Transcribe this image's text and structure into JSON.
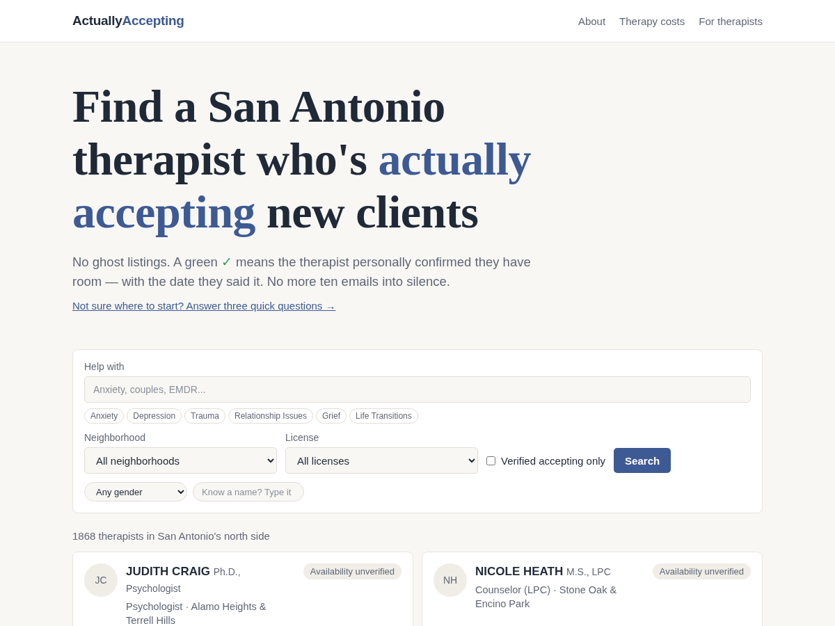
{
  "header": {
    "logo": [
      {
        "text": "Actually",
        "accent": false
      },
      {
        "text": "Accepting",
        "accent": true
      }
    ],
    "nav": [
      {
        "label": "About"
      },
      {
        "label": "Therapy costs"
      },
      {
        "label": "For therapists"
      }
    ]
  },
  "hero": {
    "heading": [
      {
        "text": "Find a San Antonio therapist who's ",
        "accent": false
      },
      {
        "text": "actually accepting",
        "accent": true
      },
      {
        "text": " new clients",
        "accent": false
      }
    ],
    "intro": [
      {
        "kind": "text",
        "text": "No ghost listings. A green "
      },
      {
        "kind": "check",
        "text": "✓"
      },
      {
        "kind": "text",
        "text": " means the therapist personally confirmed they have room — with the date they said it. No more ten emails into silence."
      }
    ],
    "quiz_link": "Not sure where to start? Answer three quick questions →"
  },
  "search": {
    "help_label": "Help with",
    "help_placeholder": "Anxiety, couples, EMDR...",
    "chips": [
      {
        "label": "Anxiety"
      },
      {
        "label": "Depression"
      },
      {
        "label": "Trauma"
      },
      {
        "label": "Relationship Issues"
      },
      {
        "label": "Grief"
      },
      {
        "label": "Life Transitions"
      }
    ],
    "neighborhood_label": "Neighborhood",
    "neighborhood_value": "All neighborhoods",
    "license_label": "License",
    "license_value": "All licenses",
    "verified_label": "Verified accepting only",
    "verified_checked": false,
    "search_button": "Search",
    "gender_value": "Any gender",
    "name_placeholder": "Know a name? Type it"
  },
  "results": {
    "count": "1868 therapists in San Antonio's north side",
    "therapists": [
      {
        "initials": "JC",
        "name": "JUDITH CRAIG",
        "credentials": "Ph.D., Psychologist",
        "details": "Psychologist · Alamo Heights & Terrell Hills",
        "badge": "Availability unverified"
      },
      {
        "initials": "NH",
        "name": "NICOLE HEATH",
        "credentials": "M.S., LPC",
        "details": "Counselor (LPC) · Stone Oak & Encino Park",
        "badge": "Availability unverified"
      }
    ]
  }
}
